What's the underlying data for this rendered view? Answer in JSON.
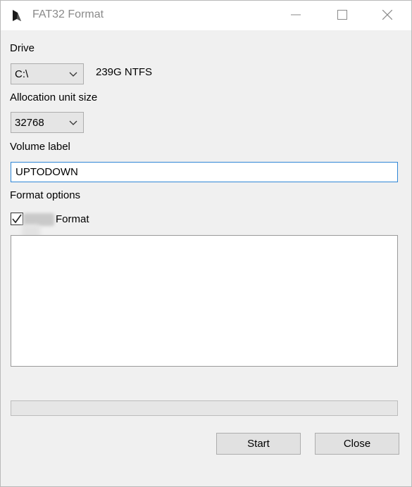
{
  "window": {
    "title": "FAT32 Format",
    "icon": "app-logo-icon",
    "controls": [
      "minimize-icon",
      "maximize-icon",
      "close-icon"
    ]
  },
  "drive": {
    "label": "Drive",
    "selected": "C:\\",
    "info": "239G NTFS"
  },
  "allocation": {
    "label": "Allocation unit size",
    "selected": "32768"
  },
  "volume": {
    "label": "Volume label",
    "value": "UPTODOWN"
  },
  "format_options": {
    "label": "Format options",
    "checkbox_label": "Format",
    "checked": true
  },
  "log": {
    "text": ""
  },
  "progress": {
    "value": 0
  },
  "buttons": {
    "start": "Start",
    "close": "Close"
  },
  "colors": {
    "window_bg": "#f0f0f0",
    "focus_border": "#2f86d6",
    "button_bg": "#e1e1e1"
  }
}
